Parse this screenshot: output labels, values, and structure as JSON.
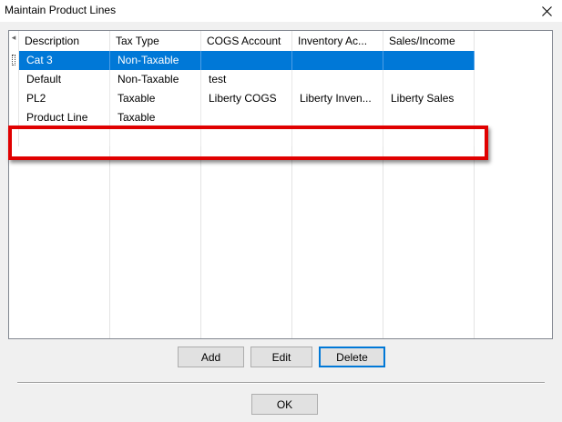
{
  "window": {
    "title": "Maintain Product Lines"
  },
  "grid": {
    "row_header_glyph": "◂",
    "columns": [
      "Description",
      "Tax Type",
      "COGS Account",
      "Inventory Ac...",
      "Sales/Income"
    ],
    "rows": [
      {
        "description": "Cat 3",
        "tax_type": "Non-Taxable",
        "cogs": "",
        "inventory": "",
        "sales": "",
        "selected": true
      },
      {
        "description": "Default",
        "tax_type": "Non-Taxable",
        "cogs": "test",
        "inventory": "",
        "sales": ""
      },
      {
        "description": "PL2",
        "tax_type": "Taxable",
        "cogs": "Liberty COGS",
        "inventory": "Liberty Inven...",
        "sales": "Liberty Sales"
      },
      {
        "description": "Product Line",
        "tax_type": "Taxable",
        "cogs": "",
        "inventory": "",
        "sales": ""
      },
      {
        "description": "",
        "tax_type": "",
        "cogs": "",
        "inventory": "",
        "sales": ""
      }
    ]
  },
  "buttons": {
    "add": "Add",
    "edit": "Edit",
    "delete": "Delete",
    "ok": "OK"
  },
  "colors": {
    "selection": "#0078d7",
    "highlight": "#e00000"
  }
}
